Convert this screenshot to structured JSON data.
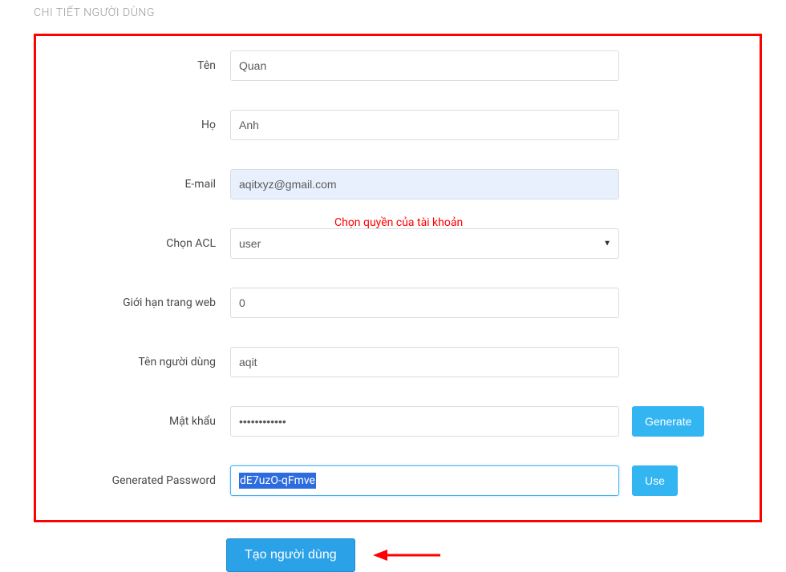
{
  "page": {
    "title": "CHI TIẾT NGƯỜI DÙNG"
  },
  "annotations": {
    "acl_hint": "Chọn quyền của tài khoản"
  },
  "form": {
    "firstname": {
      "label": "Tên",
      "value": "Quan"
    },
    "lastname": {
      "label": "Họ",
      "value": "Anh"
    },
    "email": {
      "label": "E-mail",
      "value": "aqitxyz@gmail.com"
    },
    "acl": {
      "label": "Chọn ACL",
      "value": "user"
    },
    "website_limit": {
      "label": "Giới hạn trang web",
      "value": "0"
    },
    "username": {
      "label": "Tên người dùng",
      "value": "aqit"
    },
    "password": {
      "label": "Mật khẩu",
      "value": "••••••••••••"
    },
    "generated_password": {
      "label": "Generated Password",
      "value": "dE7uzO-qFmve"
    }
  },
  "buttons": {
    "generate": "Generate",
    "use": "Use",
    "submit": "Tạo người dùng"
  }
}
